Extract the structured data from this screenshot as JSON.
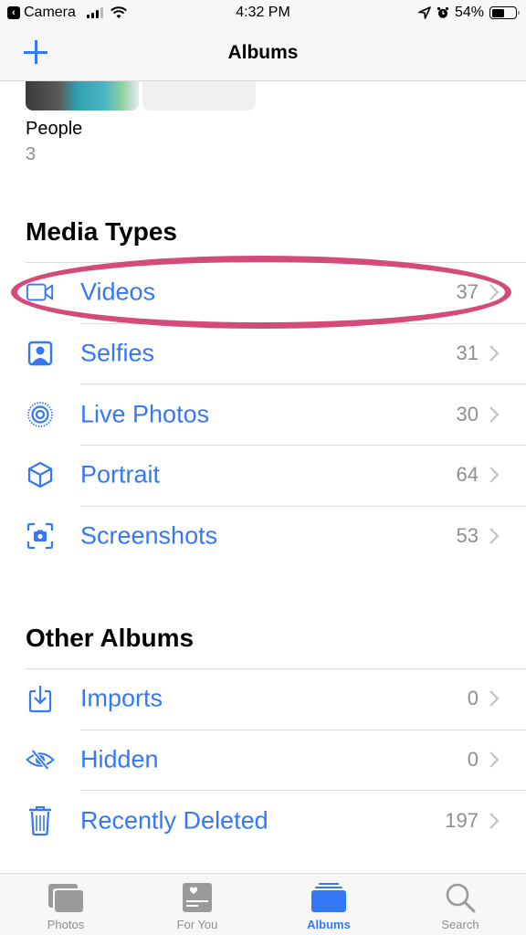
{
  "status_bar": {
    "back_app": "Camera",
    "time": "4:32 PM",
    "battery_percent_label": "54%",
    "battery_level": 0.54
  },
  "nav": {
    "title": "Albums",
    "add_icon": "plus-icon"
  },
  "people": {
    "label": "People",
    "count": "3"
  },
  "media_types": {
    "title": "Media Types",
    "items": [
      {
        "label": "Videos",
        "count": "37",
        "icon": "video-camera-icon",
        "highlighted": true
      },
      {
        "label": "Selfies",
        "count": "31",
        "icon": "person-portrait-icon"
      },
      {
        "label": "Live Photos",
        "count": "30",
        "icon": "live-photo-icon"
      },
      {
        "label": "Portrait",
        "count": "64",
        "icon": "cube-icon"
      },
      {
        "label": "Screenshots",
        "count": "53",
        "icon": "screenshot-icon"
      }
    ]
  },
  "other_albums": {
    "title": "Other Albums",
    "items": [
      {
        "label": "Imports",
        "count": "0",
        "icon": "import-icon"
      },
      {
        "label": "Hidden",
        "count": "0",
        "icon": "eye-slash-icon"
      },
      {
        "label": "Recently Deleted",
        "count": "197",
        "icon": "trash-icon"
      }
    ]
  },
  "tab_bar": {
    "tabs": [
      {
        "label": "Photos",
        "icon": "photos-stack-icon",
        "active": false
      },
      {
        "label": "For You",
        "icon": "for-you-icon",
        "active": false
      },
      {
        "label": "Albums",
        "icon": "albums-icon",
        "active": true
      },
      {
        "label": "Search",
        "icon": "magnifier-icon",
        "active": false
      }
    ]
  },
  "colors": {
    "accent": "#3478f6",
    "secondary_text": "#8e8e93",
    "annotation": "#d44a7a",
    "inactive_icon": "#999999"
  }
}
